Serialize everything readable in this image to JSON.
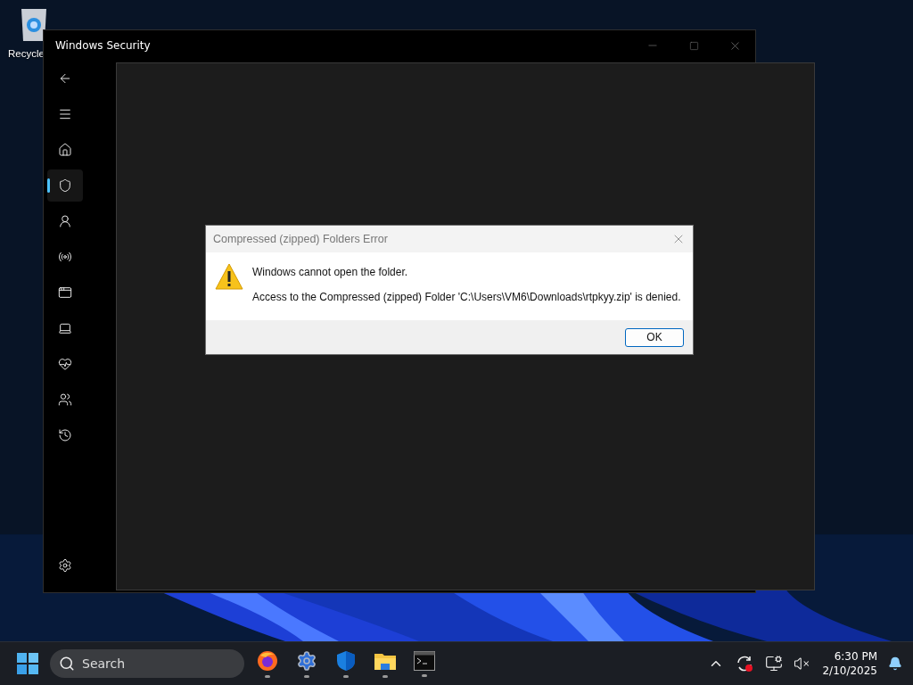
{
  "desktop": {
    "icons": [
      {
        "kind": "recycle-bin",
        "label": "Recycle"
      }
    ]
  },
  "window": {
    "title": "Windows Security",
    "sidebar": {
      "items": [
        {
          "kind": "back",
          "selected": false
        },
        {
          "kind": "menu",
          "selected": false
        },
        {
          "kind": "home",
          "selected": false
        },
        {
          "kind": "shield",
          "selected": true
        },
        {
          "kind": "account",
          "selected": false
        },
        {
          "kind": "network",
          "selected": false
        },
        {
          "kind": "app",
          "selected": false
        },
        {
          "kind": "device",
          "selected": false
        },
        {
          "kind": "health",
          "selected": false
        },
        {
          "kind": "family",
          "selected": false
        },
        {
          "kind": "history",
          "selected": false
        }
      ],
      "footer": [
        {
          "kind": "settings",
          "selected": false
        }
      ]
    }
  },
  "dialog": {
    "title": "Compressed (zipped) Folders Error",
    "message": "Windows cannot open the folder.",
    "detail": "Access to the Compressed (zipped) Folder 'C:\\Users\\VM6\\Downloads\\rtpkyy.zip' is denied.",
    "buttons": [
      "OK"
    ]
  },
  "taskbar": {
    "search": {
      "placeholder": "Search"
    },
    "apps": [
      {
        "kind": "browser",
        "running": true
      },
      {
        "kind": "settings",
        "running": true
      },
      {
        "kind": "security",
        "running": true
      },
      {
        "kind": "files",
        "running": true
      },
      {
        "kind": "terminal",
        "running": true
      }
    ],
    "tray": [
      {
        "kind": "chevron"
      },
      {
        "kind": "sync"
      },
      {
        "kind": "network"
      },
      {
        "kind": "volume-muted"
      }
    ],
    "clock": {
      "time": "6:30 PM",
      "date": "2/10/2025"
    }
  }
}
